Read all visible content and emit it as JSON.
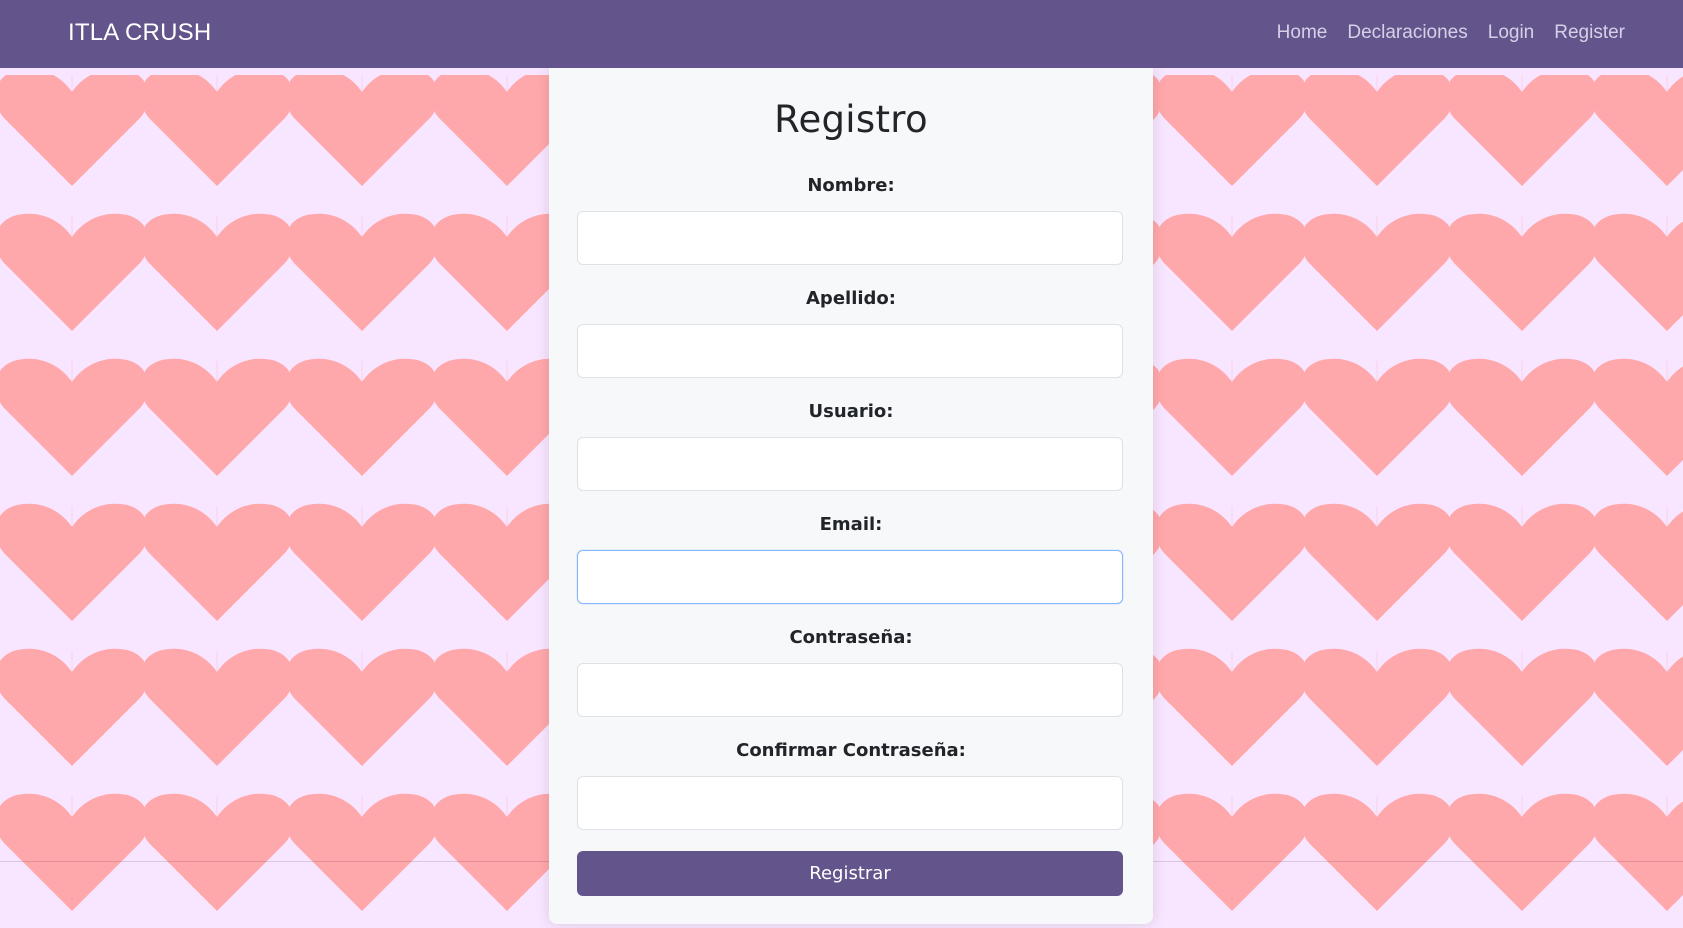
{
  "navbar": {
    "brand": "ITLA CRUSH",
    "links": [
      {
        "label": "Home"
      },
      {
        "label": "Declaraciones"
      },
      {
        "label": "Login"
      },
      {
        "label": "Register"
      }
    ]
  },
  "colors": {
    "navbar_bg": "#63558b",
    "page_bg": "#f8e5ff",
    "heart": "#ffa8ac",
    "card_bg": "#f7f8fa",
    "button_bg": "#63558b",
    "focus_border": "#86b7fe"
  },
  "background": {
    "pattern_icon": "heart-icon"
  },
  "form": {
    "title": "Registro",
    "fields": [
      {
        "label": "Nombre:",
        "value": "",
        "focused": false
      },
      {
        "label": "Apellido:",
        "value": "",
        "focused": false
      },
      {
        "label": "Usuario:",
        "value": "",
        "focused": false
      },
      {
        "label": "Email:",
        "value": "",
        "focused": true
      },
      {
        "label": "Contraseña:",
        "value": "",
        "focused": false
      },
      {
        "label": "Confirmar Contraseña:",
        "value": "",
        "focused": false
      }
    ],
    "submit_label": "Registrar"
  }
}
